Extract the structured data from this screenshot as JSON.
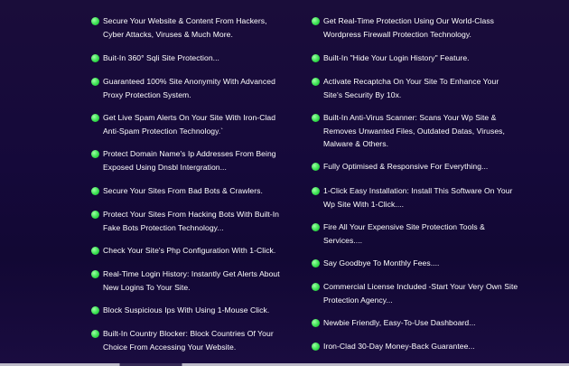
{
  "left": [
    "Secure Your Website & Content From Hackers, Cyber Attacks, Viruses & Much More.",
    "Buit-In 360° Sqli Site Protection...",
    "Guaranteed 100% Site Anonymity With Advanced Proxy Protection System.",
    "Get Live Spam Alerts On Your Site With Iron-Clad Anti-Spam Protection Technology.`",
    "Protect Domain Name's Ip Addresses From Being Exposed Using Dnsbl Intergration...",
    "Secure Your Sites From Bad Bots & Crawlers.",
    "Protect Your Sites From Hacking Bots With Built-In Fake Bots Protection Technology...",
    "Check Your Site's Php Configuration With 1-Click.",
    "Real-Time Login History: Instantly Get Alerts About New Logins To Your Site.",
    "Block Suspicious Ips With Using 1-Mouse Click.",
    "Built-In Country Blocker: Block Countries Of Your Choice From Accessing Your Website."
  ],
  "right": [
    "Get Real-Time Protection Using Our World-Class Wordpress Firewall Protection Technology.",
    "Built-In \"Hide Your Login History\" Feature.",
    "Activate Recaptcha On Your Site To Enhance Your Site's Security By 10x.",
    "Built-In Anti-Virus Scanner: Scans Your Wp Site & Removes Unwanted Files, Outdated Datas, Viruses, Malware & Others.",
    "Fully Optimised & Responsive For Everything...",
    "1-Click Easy Installation: Install This Software On Your Wp Site With 1-Click....",
    "Fire All Your Expensive Site Protection Tools & Services....",
    "Say Goodbye To Monthly Fees....",
    "Commercial License Included -Start Your Very Own Site Protection Agency...",
    "Newbie Friendly, Easy-To-Use Dashboard...",
    "Iron-Clad 30-Day Money-Back Guarantee..."
  ]
}
